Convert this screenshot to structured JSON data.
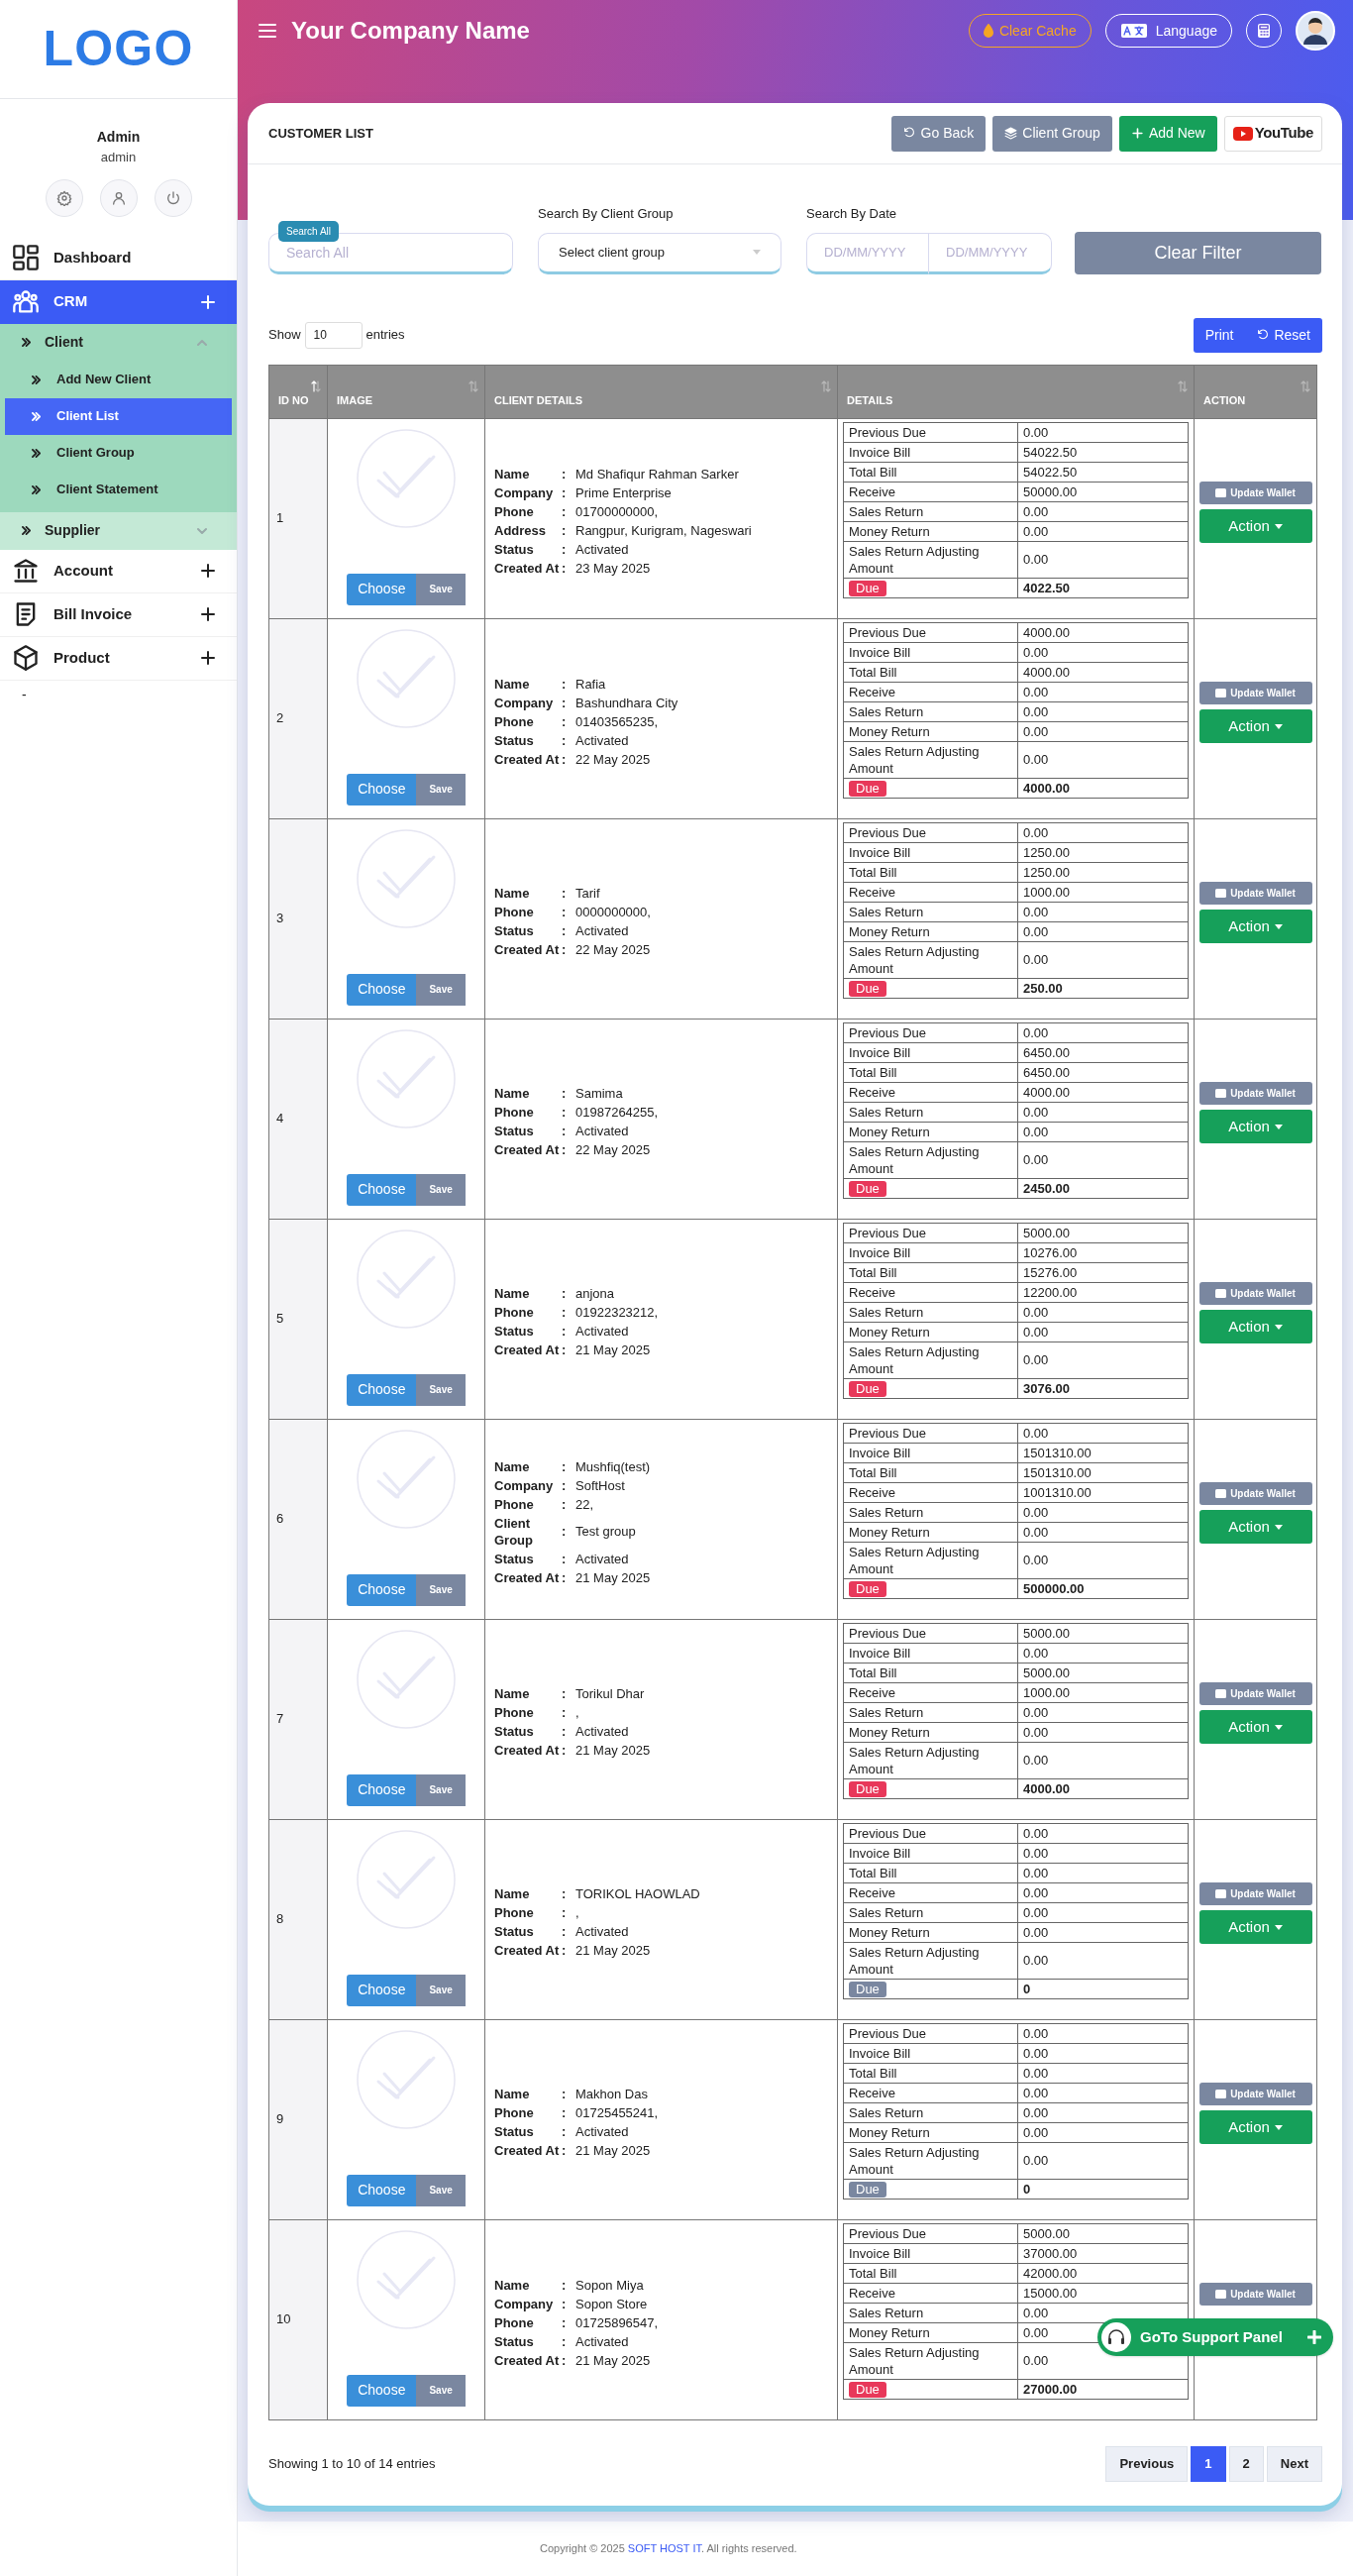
{
  "sidebar": {
    "logo": "LOGO",
    "user": {
      "name": "Admin",
      "role": "admin"
    },
    "menu": [
      {
        "label": "Dashboard",
        "selected": false,
        "expandable": false
      },
      {
        "label": "CRM",
        "selected": true,
        "expandable": true,
        "expanded": true,
        "children": [
          {
            "label": "Client",
            "expanded": true,
            "children": [
              {
                "label": "Add New Client",
                "selected": false
              },
              {
                "label": "Client List",
                "selected": true
              },
              {
                "label": "Client Group",
                "selected": false
              },
              {
                "label": "Client Statement",
                "selected": false
              }
            ]
          },
          {
            "label": "Supplier",
            "expanded": false
          }
        ]
      },
      {
        "label": "Account",
        "selected": false,
        "expandable": true,
        "expanded": false
      },
      {
        "label": "Bill Invoice",
        "selected": false,
        "expandable": true,
        "expanded": false
      },
      {
        "label": "Product",
        "selected": false,
        "expandable": true,
        "expanded": false
      }
    ],
    "footer_text": "-"
  },
  "header": {
    "title": "Your Company Name",
    "clear_cache": "Clear Cache",
    "language": "Language"
  },
  "card": {
    "title": "CUSTOMER LIST",
    "buttons": [
      "Go Back",
      "Client Group",
      "Add New"
    ],
    "youtube": "YouTube"
  },
  "filters": {
    "search_badge": "Search All",
    "search_placeholder": "Search All",
    "group_label": "Search By Client Group",
    "group_value": "Select client group",
    "date_label": "Search By Date",
    "date_from_placeholder": "DD/MM/YYYY",
    "date_to_placeholder": "DD/MM/YYYY",
    "clear": "Clear Filter"
  },
  "length": {
    "before": "Show",
    "value": "10",
    "after": "entries"
  },
  "table_buttons": [
    "Print",
    "Reset"
  ],
  "table": {
    "columns": [
      {
        "label": "ID NO",
        "sorted": true
      },
      {
        "label": "IMAGE",
        "sorted": false
      },
      {
        "label": "CLIENT DETAILS",
        "sorted": false
      },
      {
        "label": "DETAILS",
        "sorted": false
      },
      {
        "label": "ACTION",
        "sorted": false
      }
    ],
    "rows": [
      {
        "id": "1",
        "choose": "Choose",
        "save": "Save",
        "fields": [
          {
            "label": "Name",
            "sep": ":",
            "value": "Md Shafiqur Rahman Sarker"
          },
          {
            "label": "Company",
            "sep": ":",
            "value": "Prime Enterprise"
          },
          {
            "label": "Phone",
            "sep": ":",
            "value": "01700000000,"
          },
          {
            "label": "Address",
            "sep": ":",
            "value": "Rangpur, Kurigram, Nageswari"
          },
          {
            "label": "Status",
            "sep": ":",
            "value": "Activated"
          },
          {
            "label": "Created At",
            "sep": ":",
            "value": "23 May 2025"
          }
        ],
        "details": [
          {
            "label": "Previous Due",
            "value": "0.00"
          },
          {
            "label": "Invoice Bill",
            "value": "54022.50"
          },
          {
            "label": "Total Bill",
            "value": "54022.50"
          },
          {
            "label": "Receive",
            "value": "50000.00"
          },
          {
            "label": "Sales Return",
            "value": "0.00"
          },
          {
            "label": "Money Return",
            "value": "0.00"
          },
          {
            "label": "Sales Return Adjusting Amount",
            "value": "0.00"
          }
        ],
        "due": {
          "label": "Due",
          "value": "4022.50",
          "color": "#e8385a"
        },
        "update_wallet": "Update Wallet",
        "action": "Action"
      },
      {
        "id": "2",
        "choose": "Choose",
        "save": "Save",
        "fields": [
          {
            "label": "Name",
            "sep": ":",
            "value": "Rafia"
          },
          {
            "label": "Company",
            "sep": ":",
            "value": "Bashundhara City"
          },
          {
            "label": "Phone",
            "sep": ":",
            "value": "01403565235,"
          },
          {
            "label": "Status",
            "sep": ":",
            "value": "Activated"
          },
          {
            "label": "Created At",
            "sep": ":",
            "value": "22 May 2025"
          }
        ],
        "details": [
          {
            "label": "Previous Due",
            "value": "4000.00"
          },
          {
            "label": "Invoice Bill",
            "value": "0.00"
          },
          {
            "label": "Total Bill",
            "value": "4000.00"
          },
          {
            "label": "Receive",
            "value": "0.00"
          },
          {
            "label": "Sales Return",
            "value": "0.00"
          },
          {
            "label": "Money Return",
            "value": "0.00"
          },
          {
            "label": "Sales Return Adjusting Amount",
            "value": "0.00"
          }
        ],
        "due": {
          "label": "Due",
          "value": "4000.00",
          "color": "#e8385a"
        },
        "update_wallet": "Update Wallet",
        "action": "Action"
      },
      {
        "id": "3",
        "choose": "Choose",
        "save": "Save",
        "fields": [
          {
            "label": "Name",
            "sep": ":",
            "value": "Tarif"
          },
          {
            "label": "Phone",
            "sep": ":",
            "value": "0000000000,"
          },
          {
            "label": "Status",
            "sep": ":",
            "value": "Activated"
          },
          {
            "label": "Created At",
            "sep": ":",
            "value": "22 May 2025"
          }
        ],
        "details": [
          {
            "label": "Previous Due",
            "value": "0.00"
          },
          {
            "label": "Invoice Bill",
            "value": "1250.00"
          },
          {
            "label": "Total Bill",
            "value": "1250.00"
          },
          {
            "label": "Receive",
            "value": "1000.00"
          },
          {
            "label": "Sales Return",
            "value": "0.00"
          },
          {
            "label": "Money Return",
            "value": "0.00"
          },
          {
            "label": "Sales Return Adjusting Amount",
            "value": "0.00"
          }
        ],
        "due": {
          "label": "Due",
          "value": "250.00",
          "color": "#e8385a"
        },
        "update_wallet": "Update Wallet",
        "action": "Action"
      },
      {
        "id": "4",
        "choose": "Choose",
        "save": "Save",
        "fields": [
          {
            "label": "Name",
            "sep": ":",
            "value": "Samima"
          },
          {
            "label": "Phone",
            "sep": ":",
            "value": "01987264255,"
          },
          {
            "label": "Status",
            "sep": ":",
            "value": "Activated"
          },
          {
            "label": "Created At",
            "sep": ":",
            "value": "22 May 2025"
          }
        ],
        "details": [
          {
            "label": "Previous Due",
            "value": "0.00"
          },
          {
            "label": "Invoice Bill",
            "value": "6450.00"
          },
          {
            "label": "Total Bill",
            "value": "6450.00"
          },
          {
            "label": "Receive",
            "value": "4000.00"
          },
          {
            "label": "Sales Return",
            "value": "0.00"
          },
          {
            "label": "Money Return",
            "value": "0.00"
          },
          {
            "label": "Sales Return Adjusting Amount",
            "value": "0.00"
          }
        ],
        "due": {
          "label": "Due",
          "value": "2450.00",
          "color": "#e8385a"
        },
        "update_wallet": "Update Wallet",
        "action": "Action"
      },
      {
        "id": "5",
        "choose": "Choose",
        "save": "Save",
        "fields": [
          {
            "label": "Name",
            "sep": ":",
            "value": "anjona"
          },
          {
            "label": "Phone",
            "sep": ":",
            "value": "01922323212,"
          },
          {
            "label": "Status",
            "sep": ":",
            "value": "Activated"
          },
          {
            "label": "Created At",
            "sep": ":",
            "value": "21 May 2025"
          }
        ],
        "details": [
          {
            "label": "Previous Due",
            "value": "5000.00"
          },
          {
            "label": "Invoice Bill",
            "value": "10276.00"
          },
          {
            "label": "Total Bill",
            "value": "15276.00"
          },
          {
            "label": "Receive",
            "value": "12200.00"
          },
          {
            "label": "Sales Return",
            "value": "0.00"
          },
          {
            "label": "Money Return",
            "value": "0.00"
          },
          {
            "label": "Sales Return Adjusting Amount",
            "value": "0.00"
          }
        ],
        "due": {
          "label": "Due",
          "value": "3076.00",
          "color": "#e8385a"
        },
        "update_wallet": "Update Wallet",
        "action": "Action"
      },
      {
        "id": "6",
        "choose": "Choose",
        "save": "Save",
        "fields": [
          {
            "label": "Name",
            "sep": ":",
            "value": "Mushfiq(test)"
          },
          {
            "label": "Company",
            "sep": ":",
            "value": "SoftHost"
          },
          {
            "label": "Phone",
            "sep": ":",
            "value": "22,"
          },
          {
            "label": "Client Group",
            "sep": ":",
            "value": "Test group"
          },
          {
            "label": "Status",
            "sep": ":",
            "value": "Activated"
          },
          {
            "label": "Created At",
            "sep": ":",
            "value": "21 May 2025"
          }
        ],
        "details": [
          {
            "label": "Previous Due",
            "value": "0.00"
          },
          {
            "label": "Invoice Bill",
            "value": "1501310.00"
          },
          {
            "label": "Total Bill",
            "value": "1501310.00"
          },
          {
            "label": "Receive",
            "value": "1001310.00"
          },
          {
            "label": "Sales Return",
            "value": "0.00"
          },
          {
            "label": "Money Return",
            "value": "0.00"
          },
          {
            "label": "Sales Return Adjusting Amount",
            "value": "0.00"
          }
        ],
        "due": {
          "label": "Due",
          "value": "500000.00",
          "color": "#e8385a"
        },
        "update_wallet": "Update Wallet",
        "action": "Action"
      },
      {
        "id": "7",
        "choose": "Choose",
        "save": "Save",
        "fields": [
          {
            "label": "Name",
            "sep": ":",
            "value": "Torikul Dhar"
          },
          {
            "label": "Phone",
            "sep": ":",
            "value": ","
          },
          {
            "label": "Status",
            "sep": ":",
            "value": "Activated"
          },
          {
            "label": "Created At",
            "sep": ":",
            "value": "21 May 2025"
          }
        ],
        "details": [
          {
            "label": "Previous Due",
            "value": "5000.00"
          },
          {
            "label": "Invoice Bill",
            "value": "0.00"
          },
          {
            "label": "Total Bill",
            "value": "5000.00"
          },
          {
            "label": "Receive",
            "value": "1000.00"
          },
          {
            "label": "Sales Return",
            "value": "0.00"
          },
          {
            "label": "Money Return",
            "value": "0.00"
          },
          {
            "label": "Sales Return Adjusting Amount",
            "value": "0.00"
          }
        ],
        "due": {
          "label": "Due",
          "value": "4000.00",
          "color": "#e8385a"
        },
        "update_wallet": "Update Wallet",
        "action": "Action"
      },
      {
        "id": "8",
        "choose": "Choose",
        "save": "Save",
        "fields": [
          {
            "label": "Name",
            "sep": ":",
            "value": "TORIKOL HAOWLAD"
          },
          {
            "label": "Phone",
            "sep": ":",
            "value": ","
          },
          {
            "label": "Status",
            "sep": ":",
            "value": "Activated"
          },
          {
            "label": "Created At",
            "sep": ":",
            "value": "21 May 2025"
          }
        ],
        "details": [
          {
            "label": "Previous Due",
            "value": "0.00"
          },
          {
            "label": "Invoice Bill",
            "value": "0.00"
          },
          {
            "label": "Total Bill",
            "value": "0.00"
          },
          {
            "label": "Receive",
            "value": "0.00"
          },
          {
            "label": "Sales Return",
            "value": "0.00"
          },
          {
            "label": "Money Return",
            "value": "0.00"
          },
          {
            "label": "Sales Return Adjusting Amount",
            "value": "0.00"
          }
        ],
        "due": {
          "label": "Due",
          "value": "0",
          "color": "#7a87a0"
        },
        "update_wallet": "Update Wallet",
        "action": "Action"
      },
      {
        "id": "9",
        "choose": "Choose",
        "save": "Save",
        "fields": [
          {
            "label": "Name",
            "sep": ":",
            "value": "Makhon Das"
          },
          {
            "label": "Phone",
            "sep": ":",
            "value": "01725455241,"
          },
          {
            "label": "Status",
            "sep": ":",
            "value": "Activated"
          },
          {
            "label": "Created At",
            "sep": ":",
            "value": "21 May 2025"
          }
        ],
        "details": [
          {
            "label": "Previous Due",
            "value": "0.00"
          },
          {
            "label": "Invoice Bill",
            "value": "0.00"
          },
          {
            "label": "Total Bill",
            "value": "0.00"
          },
          {
            "label": "Receive",
            "value": "0.00"
          },
          {
            "label": "Sales Return",
            "value": "0.00"
          },
          {
            "label": "Money Return",
            "value": "0.00"
          },
          {
            "label": "Sales Return Adjusting Amount",
            "value": "0.00"
          }
        ],
        "due": {
          "label": "Due",
          "value": "0",
          "color": "#7a87a0"
        },
        "update_wallet": "Update Wallet",
        "action": "Action"
      },
      {
        "id": "10",
        "choose": "Choose",
        "save": "Save",
        "fields": [
          {
            "label": "Name",
            "sep": ":",
            "value": "Sopon Miya"
          },
          {
            "label": "Company",
            "sep": ":",
            "value": "Sopon Store"
          },
          {
            "label": "Phone",
            "sep": ":",
            "value": "01725896547,"
          },
          {
            "label": "Status",
            "sep": ":",
            "value": "Activated"
          },
          {
            "label": "Created At",
            "sep": ":",
            "value": "21 May 2025"
          }
        ],
        "details": [
          {
            "label": "Previous Due",
            "value": "5000.00"
          },
          {
            "label": "Invoice Bill",
            "value": "37000.00"
          },
          {
            "label": "Total Bill",
            "value": "42000.00"
          },
          {
            "label": "Receive",
            "value": "15000.00"
          },
          {
            "label": "Sales Return",
            "value": "0.00"
          },
          {
            "label": "Money Return",
            "value": "0.00"
          },
          {
            "label": "Sales Return Adjusting Amount",
            "value": "0.00"
          }
        ],
        "due": {
          "label": "Due",
          "value": "27000.00",
          "color": "#e8385a"
        },
        "update_wallet": "Update Wallet"
      }
    ]
  },
  "info": "Showing 1 to 10 of 14 entries",
  "pagination": [
    {
      "label": "Previous",
      "selected": false
    },
    {
      "label": "1",
      "selected": true
    },
    {
      "label": "2",
      "selected": false
    },
    {
      "label": "Next",
      "selected": false
    }
  ],
  "support": "GoTo Support Panel",
  "footer": {
    "before": "Copyright © 2025 ",
    "link": "SOFT HOST IT",
    "after": ". All rights reserved."
  }
}
